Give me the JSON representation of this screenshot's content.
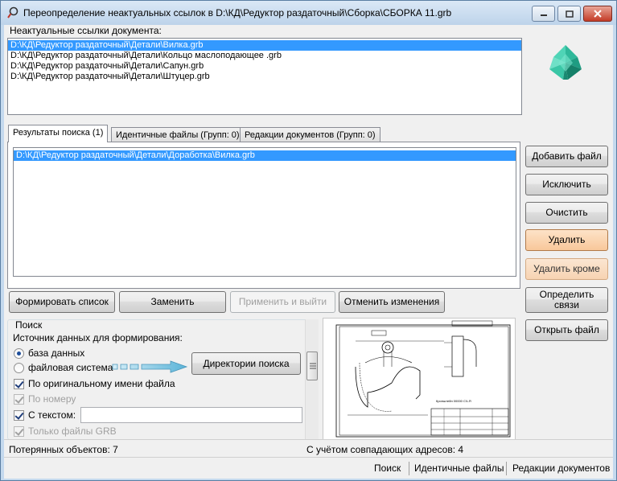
{
  "window": {
    "title": "Переопределение неактуальных ссылок в D:\\КД\\Редуктор раздаточный\\Сборка\\СБОРКА 11.grb"
  },
  "outdated_links": {
    "label": "Неактуальные ссылки документа:",
    "items": [
      {
        "text": "D:\\КД\\Редуктор раздаточный\\Детали\\Вилка.grb",
        "selected": true
      },
      {
        "text": "D:\\КД\\Редуктор раздаточный\\Детали\\Кольцо маслоподающее .grb",
        "selected": false
      },
      {
        "text": "D:\\КД\\Редуктор раздаточный\\Детали\\Сапун.grb",
        "selected": false
      },
      {
        "text": "D:\\КД\\Редуктор раздаточный\\Детали\\Штуцер.grb",
        "selected": false
      }
    ]
  },
  "tabs": [
    {
      "label": "Результаты поиска (1)",
      "active": true
    },
    {
      "label": "Идентичные файлы (Групп: 0)",
      "active": false
    },
    {
      "label": "Редакции документов (Групп: 0)",
      "active": false
    }
  ],
  "results": {
    "items": [
      {
        "text": "D:\\КД\\Редуктор раздаточный\\Детали\\Доработка\\Вилка.grb",
        "selected": true
      }
    ]
  },
  "side_buttons": {
    "add_file": "Добавить файл",
    "exclude": "Исключить",
    "clear": "Очистить",
    "delete": "Удалить",
    "delete_except": "Удалить кроме",
    "define_links": "Определить связи",
    "open_file": "Открыть файл"
  },
  "bottom_buttons": {
    "form_list": "Формировать список",
    "replace": "Заменить",
    "apply_exit": "Применить и выйти",
    "cancel_changes": "Отменить изменения"
  },
  "search": {
    "group_title": "Поиск",
    "source_label": "Источник данных для формирования:",
    "source_db": "база данных",
    "source_fs": "файловая система",
    "source_selected": "база данных",
    "directories_button": "Директории поиска",
    "by_original_name": "По оригинальному имени файла",
    "by_number": "По номеру",
    "with_text": "С текстом:",
    "with_text_value": "",
    "only_grb": "Только файлы GRB"
  },
  "status": {
    "lost_objects": "Потерянных объектов: 7",
    "matching_addresses": "С учётом совпадающих адресов: 4"
  },
  "footer_tabs": [
    "Поиск",
    "Идентичные файлы",
    "Редакции документов"
  ],
  "preview": {
    "caption": "Кронштейн 00000 СЧ-Я"
  },
  "colors": {
    "selection": "#3399ff",
    "orange_button": "#f8c79a",
    "arrow": "#5bb4d8"
  }
}
